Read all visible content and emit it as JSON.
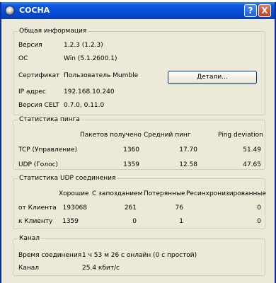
{
  "window": {
    "title": "СОСНА",
    "help_glyph": "?",
    "close_glyph": "X",
    "icon": "mumble-app-icon"
  },
  "general": {
    "legend": "Общая информация",
    "version_label": "Версия",
    "version_value": "1.2.3 (1.2.3)",
    "os_label": "ОС",
    "os_value": "Win (5.1.2600.1)",
    "cert_label": "Сертификат",
    "cert_value": "Пользователь Mumble",
    "details_button": "Детали...",
    "ip_label": "IP адрес",
    "ip_value": "192.168.10.240",
    "celt_label": "Версия CELT",
    "celt_value": "0.7.0, 0.11.0"
  },
  "ping": {
    "legend": "Статистика пинга",
    "headers": [
      "Пакетов получено",
      "Средний пинг",
      "Ping deviation"
    ],
    "rows": [
      {
        "label": "TCP (Управление)",
        "packets": "1360",
        "avg": "17.70",
        "dev": "51.49"
      },
      {
        "label": "UDP (Голос)",
        "packets": "1359",
        "avg": "12.58",
        "dev": "47.65"
      }
    ]
  },
  "udp": {
    "legend": "Статистика UDP соединения",
    "headers": [
      "Хорошие",
      "С запозданием",
      "Потерянные",
      "Ресинхронизированные"
    ],
    "rows": [
      {
        "label": "от Клиента",
        "good": "193068",
        "late": "261",
        "lost": "76",
        "resync": "0"
      },
      {
        "label": "к Клиенту",
        "good": "1359",
        "late": "0",
        "lost": "1",
        "resync": "0"
      }
    ]
  },
  "channel": {
    "legend": "Канал",
    "time_label": "Время соединения",
    "time_value": "1 ч 53 м 26 с онлайн (0 с простой)",
    "bw_label": "Канал",
    "bw_value": "25.4 кбит/с"
  }
}
